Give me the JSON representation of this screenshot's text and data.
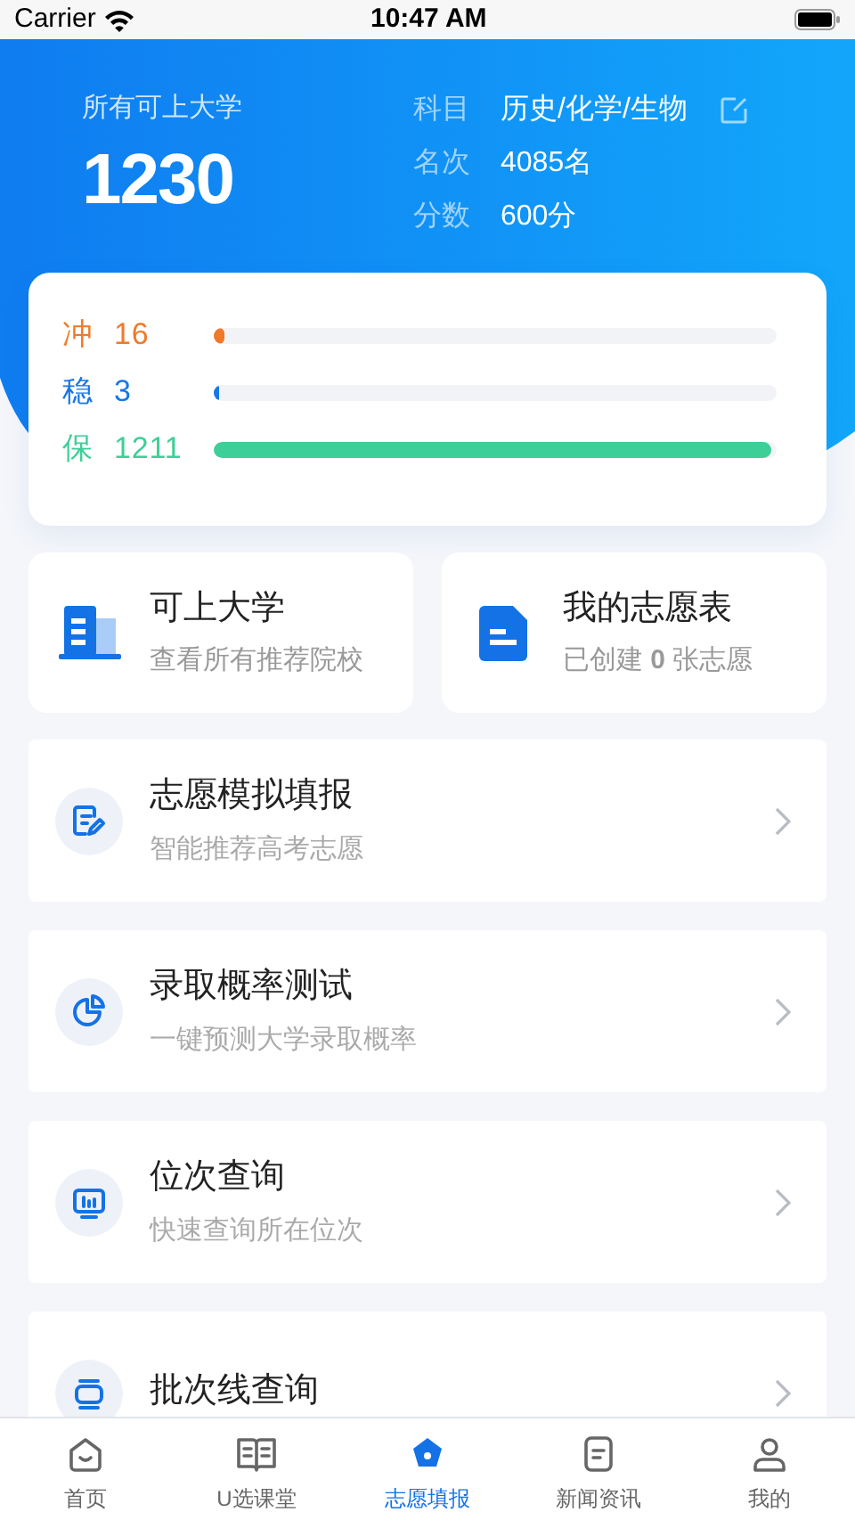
{
  "status_bar": {
    "carrier": "Carrier",
    "time": "10:47 AM"
  },
  "header": {
    "label": "所有可上大学",
    "count": "1230",
    "info": [
      {
        "label": "科目",
        "value": "历史/化学/生物",
        "editable": true
      },
      {
        "label": "名次",
        "value": "4085名",
        "editable": false
      },
      {
        "label": "分数",
        "value": "600分",
        "editable": false
      }
    ]
  },
  "levels": [
    {
      "label": "冲",
      "count": "16",
      "color": "#ef7a2a",
      "level": 0.02
    },
    {
      "label": "稳",
      "count": "3",
      "color": "#1677e6",
      "level": 0.01
    },
    {
      "label": "保",
      "count": "1211",
      "color": "#3ecf98",
      "level": 0.99
    }
  ],
  "shortcuts": [
    {
      "kind": "building",
      "title": "可上大学",
      "subtitle": "查看所有推荐院校"
    },
    {
      "kind": "document",
      "title": "我的志愿表",
      "subtitle": "已创建 **0** 张志愿"
    }
  ],
  "features": [
    {
      "kind": "edit",
      "title": "志愿模拟填报",
      "subtitle": "智能推荐高考志愿"
    },
    {
      "kind": "pie",
      "title": "录取概率测试",
      "subtitle": "一键预测大学录取概率"
    },
    {
      "kind": "monitor",
      "title": "位次查询",
      "subtitle": "快速查询所在位次"
    },
    {
      "kind": "lines",
      "title": "批次线查询"
    }
  ],
  "tabs": [
    {
      "kind": "home",
      "label": "首页",
      "selected": false
    },
    {
      "kind": "book",
      "label": "U选课堂",
      "selected": false
    },
    {
      "kind": "pen",
      "label": "志愿填报",
      "selected": true
    },
    {
      "kind": "news",
      "label": "新闻资讯",
      "selected": false
    },
    {
      "kind": "user",
      "label": "我的",
      "selected": false
    }
  ]
}
